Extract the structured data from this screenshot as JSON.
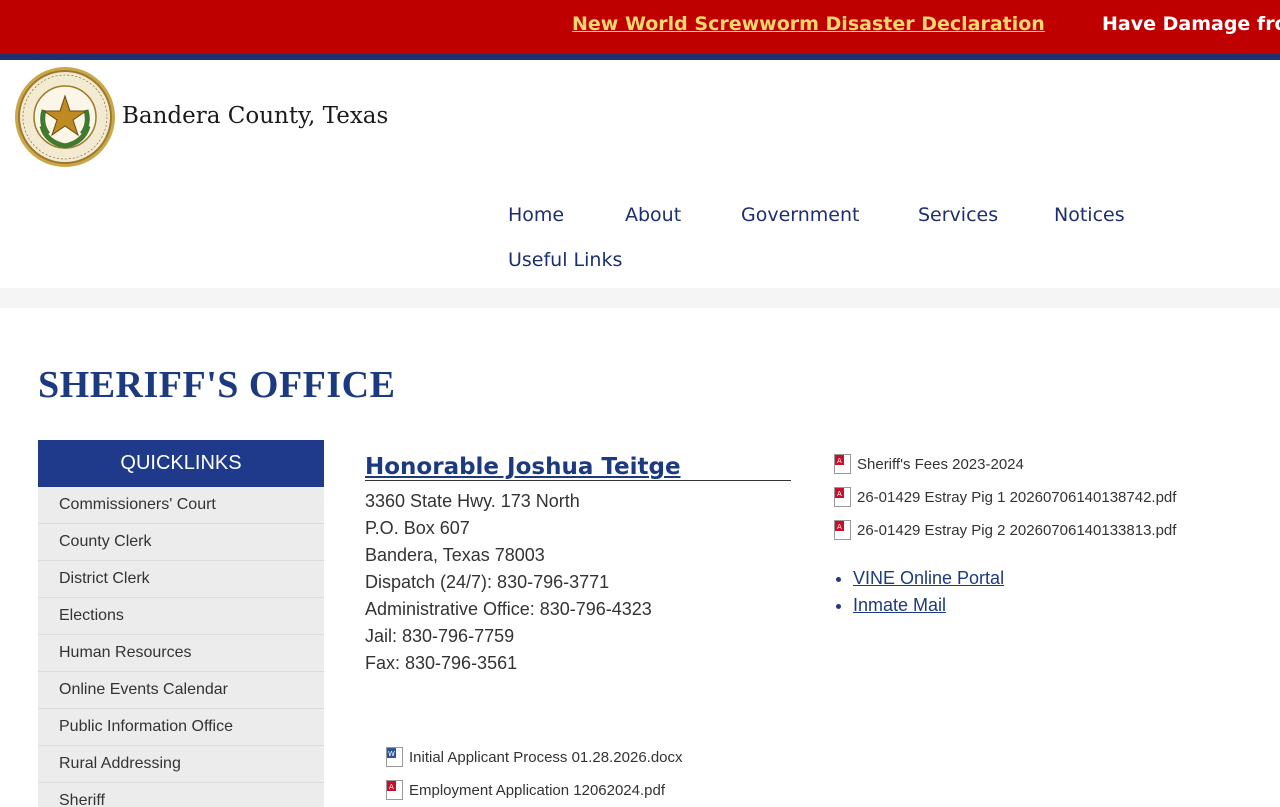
{
  "alert": {
    "headline": "New World Screwworm Disaster Declaration",
    "next_headline": "Have Damage from"
  },
  "site": {
    "name": "Bandera County, Texas"
  },
  "nav": [
    "Home",
    "About",
    "Government",
    "Services",
    "Notices",
    "Useful Links"
  ],
  "page": {
    "title": "SHERIFF'S OFFICE"
  },
  "quicklinks": {
    "title": "QUICKLINKS",
    "items": [
      "Commissioners' Court",
      "County Clerk",
      "District Clerk",
      "Elections",
      "Human Resources",
      "Online Events Calendar",
      "Public Information Office",
      "Rural Addressing",
      "Sheriff"
    ]
  },
  "sheriff": {
    "name": "Honorable Joshua Teitge",
    "contact": [
      "3360 State Hwy. 173 North",
      "P.O. Box 607",
      "Bandera, Texas 78003",
      "Dispatch (24/7): 830-796-3771",
      "Administrative Office: 830-796-4323",
      "Jail: 830-796-7759",
      "Fax: 830-796-3561"
    ]
  },
  "documents": [
    {
      "label": "Sheriff's Fees 2023-2024",
      "icon": "pdf-icon"
    },
    {
      "label": "26-01429 Estray Pig 1 20260706140138742.pdf",
      "icon": "pdf-icon"
    },
    {
      "label": "26-01429 Estray Pig 2 20260706140133813.pdf",
      "icon": "pdf-icon"
    }
  ],
  "links": [
    "VINE Online Portal",
    "Inmate Mail"
  ],
  "employment_documents": [
    {
      "label": "Initial Applicant Process 01.28.2026.docx",
      "icon": "word-doc-icon"
    },
    {
      "label": "Employment Application 12062024.pdf",
      "icon": "pdf-icon"
    }
  ],
  "colors": {
    "alert_bg": "#bf0000",
    "alert_link": "#f5d76e",
    "nav_text": "#1c2f6e",
    "title": "#1c3a80",
    "quicklinks_header": "#1f3a8a"
  }
}
